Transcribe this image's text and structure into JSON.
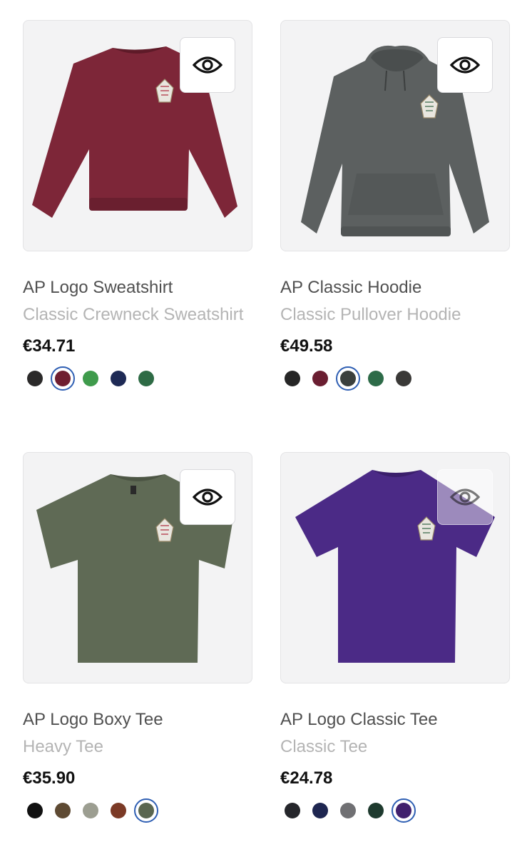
{
  "products": [
    {
      "title": "AP Logo Sweatshirt",
      "subtitle": "Classic Crewneck Sweatshirt",
      "price": "€34.71",
      "garment_color": "#7d2638",
      "garment_type": "sweatshirt",
      "quick_view_icon": "eye-icon",
      "swatches": [
        "#2b2a2a",
        "#6f1e30",
        "#3f9b4c",
        "#1e2a55",
        "#2e6b45"
      ],
      "selected_swatch": 1
    },
    {
      "title": "AP Classic Hoodie",
      "subtitle": "Classic Pullover Hoodie",
      "price": "€49.58",
      "garment_color": "#5c6060",
      "garment_type": "hoodie",
      "quick_view_icon": "eye-icon",
      "swatches": [
        "#262626",
        "#6a1e31",
        "#3b403d",
        "#2d6b48",
        "#3a3937"
      ],
      "selected_swatch": 2
    },
    {
      "title": "AP Logo Boxy Tee",
      "subtitle": "Heavy Tee",
      "price": "€35.90",
      "garment_color": "#5f6a55",
      "garment_type": "tee",
      "quick_view_icon": "eye-icon",
      "swatches": [
        "#111111",
        "#5e4a33",
        "#9c9e91",
        "#7b3a26",
        "#5a6650"
      ],
      "selected_swatch": 4
    },
    {
      "title": "AP Logo Classic Tee",
      "subtitle": "Classic Tee",
      "price": "€24.78",
      "garment_color": "#4b2a86",
      "garment_type": "tee",
      "quick_view_icon": "eye-icon",
      "swatches": [
        "#25262b",
        "#1e2650",
        "#707073",
        "#1e3a2e",
        "#41216d"
      ],
      "selected_swatch": 4
    }
  ]
}
